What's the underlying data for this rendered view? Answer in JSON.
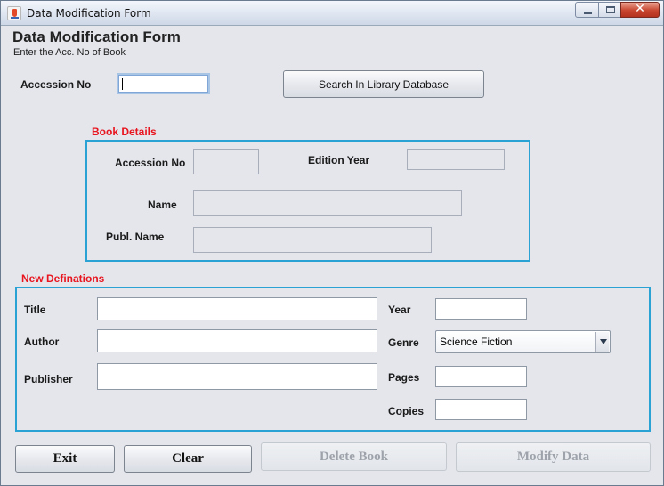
{
  "window": {
    "title": "Data Modification Form"
  },
  "header": {
    "title": "Data Modification Form",
    "subtitle": "Enter the Acc. No of Book"
  },
  "search": {
    "accession_label": "Accession No",
    "accession_value": "",
    "search_button": "Search In Library Database"
  },
  "book_details": {
    "section_title": "Book Details",
    "accession_label": "Accession No",
    "edition_year_label": "Edition Year",
    "name_label": "Name",
    "publ_name_label": "Publ. Name",
    "accession_value": "",
    "edition_year_value": "",
    "name_value": "",
    "publ_name_value": ""
  },
  "new_definitions": {
    "section_title": "New Definations",
    "title_label": "Title",
    "author_label": "Author",
    "publisher_label": "Publisher",
    "year_label": "Year",
    "genre_label": "Genre",
    "pages_label": "Pages",
    "copies_label": "Copies",
    "title_value": "",
    "author_value": "",
    "publisher_value": "",
    "year_value": "",
    "genre_selected": "Science Fiction",
    "pages_value": "",
    "copies_value": ""
  },
  "actions": {
    "exit": "Exit",
    "clear": "Clear",
    "delete": "Delete Book",
    "modify": "Modify Data"
  },
  "colors": {
    "section_title": "#e8141e",
    "panel_border": "#2aa3d4",
    "background": "#e4e6ec"
  }
}
